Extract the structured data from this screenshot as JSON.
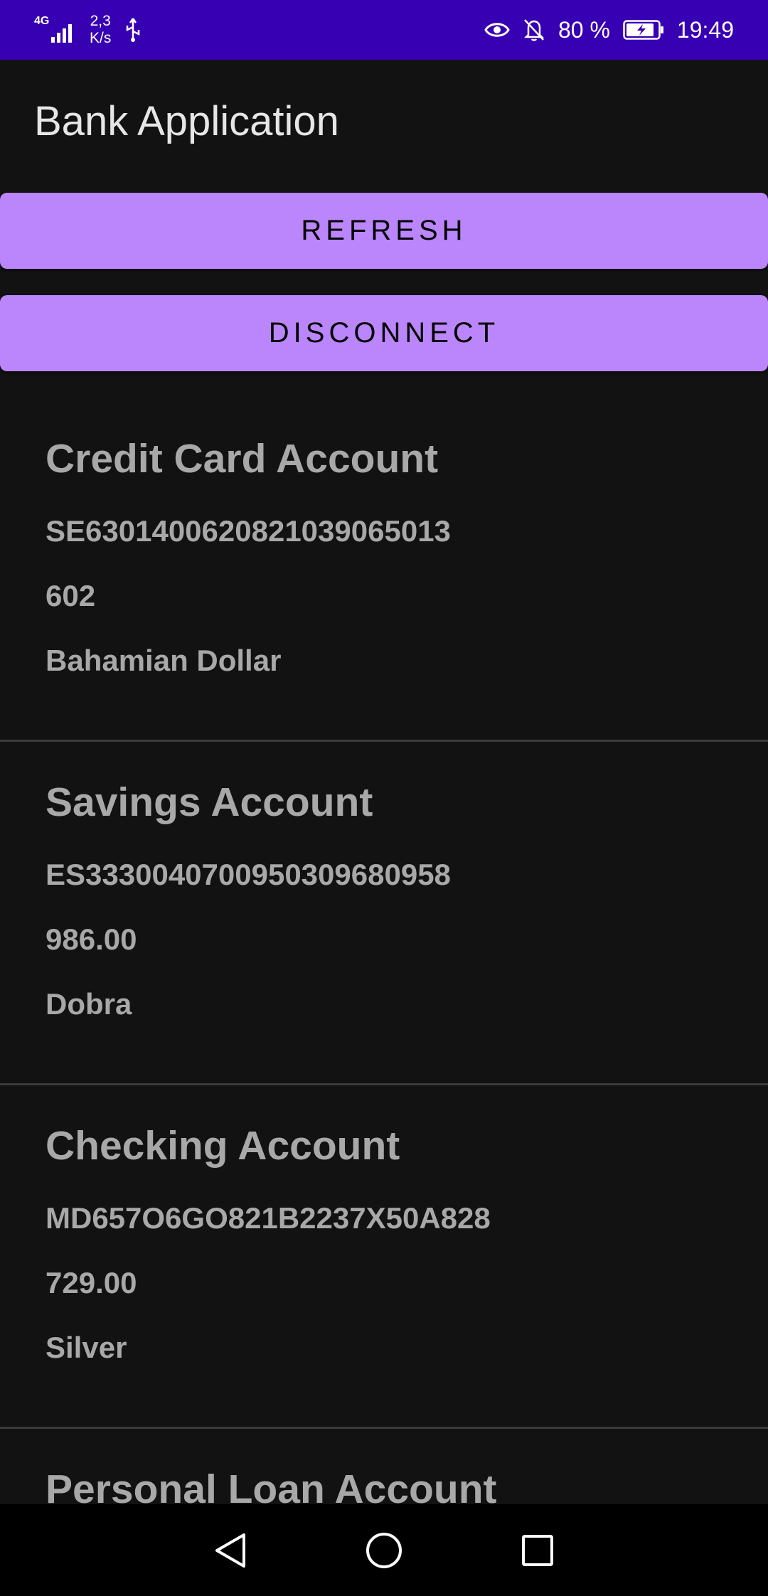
{
  "status_bar": {
    "network_type": "4G",
    "speed": "2,3",
    "speed_unit": "K/s",
    "battery": "80 %",
    "time": "19:49",
    "icons": [
      "signal-icon",
      "usb-icon",
      "eye-icon",
      "bell-off-icon",
      "battery-charging-icon"
    ]
  },
  "app": {
    "title": "Bank Application"
  },
  "buttons": {
    "refresh": "REFRESH",
    "disconnect": "DISCONNECT"
  },
  "accounts": [
    {
      "name": "Credit Card Account",
      "iban": "SE6301400620821039065013",
      "balance": "602",
      "currency": "Bahamian Dollar"
    },
    {
      "name": "Savings Account",
      "iban": "ES3330040700950309680958",
      "balance": "986.00",
      "currency": "Dobra"
    },
    {
      "name": "Checking Account",
      "iban": "MD657O6GO821B2237X50A828",
      "balance": "729.00",
      "currency": "Silver"
    },
    {
      "name": "Personal Loan Account"
    }
  ],
  "nav_bar": {
    "icons": [
      "back-icon",
      "home-icon",
      "recents-icon"
    ]
  }
}
